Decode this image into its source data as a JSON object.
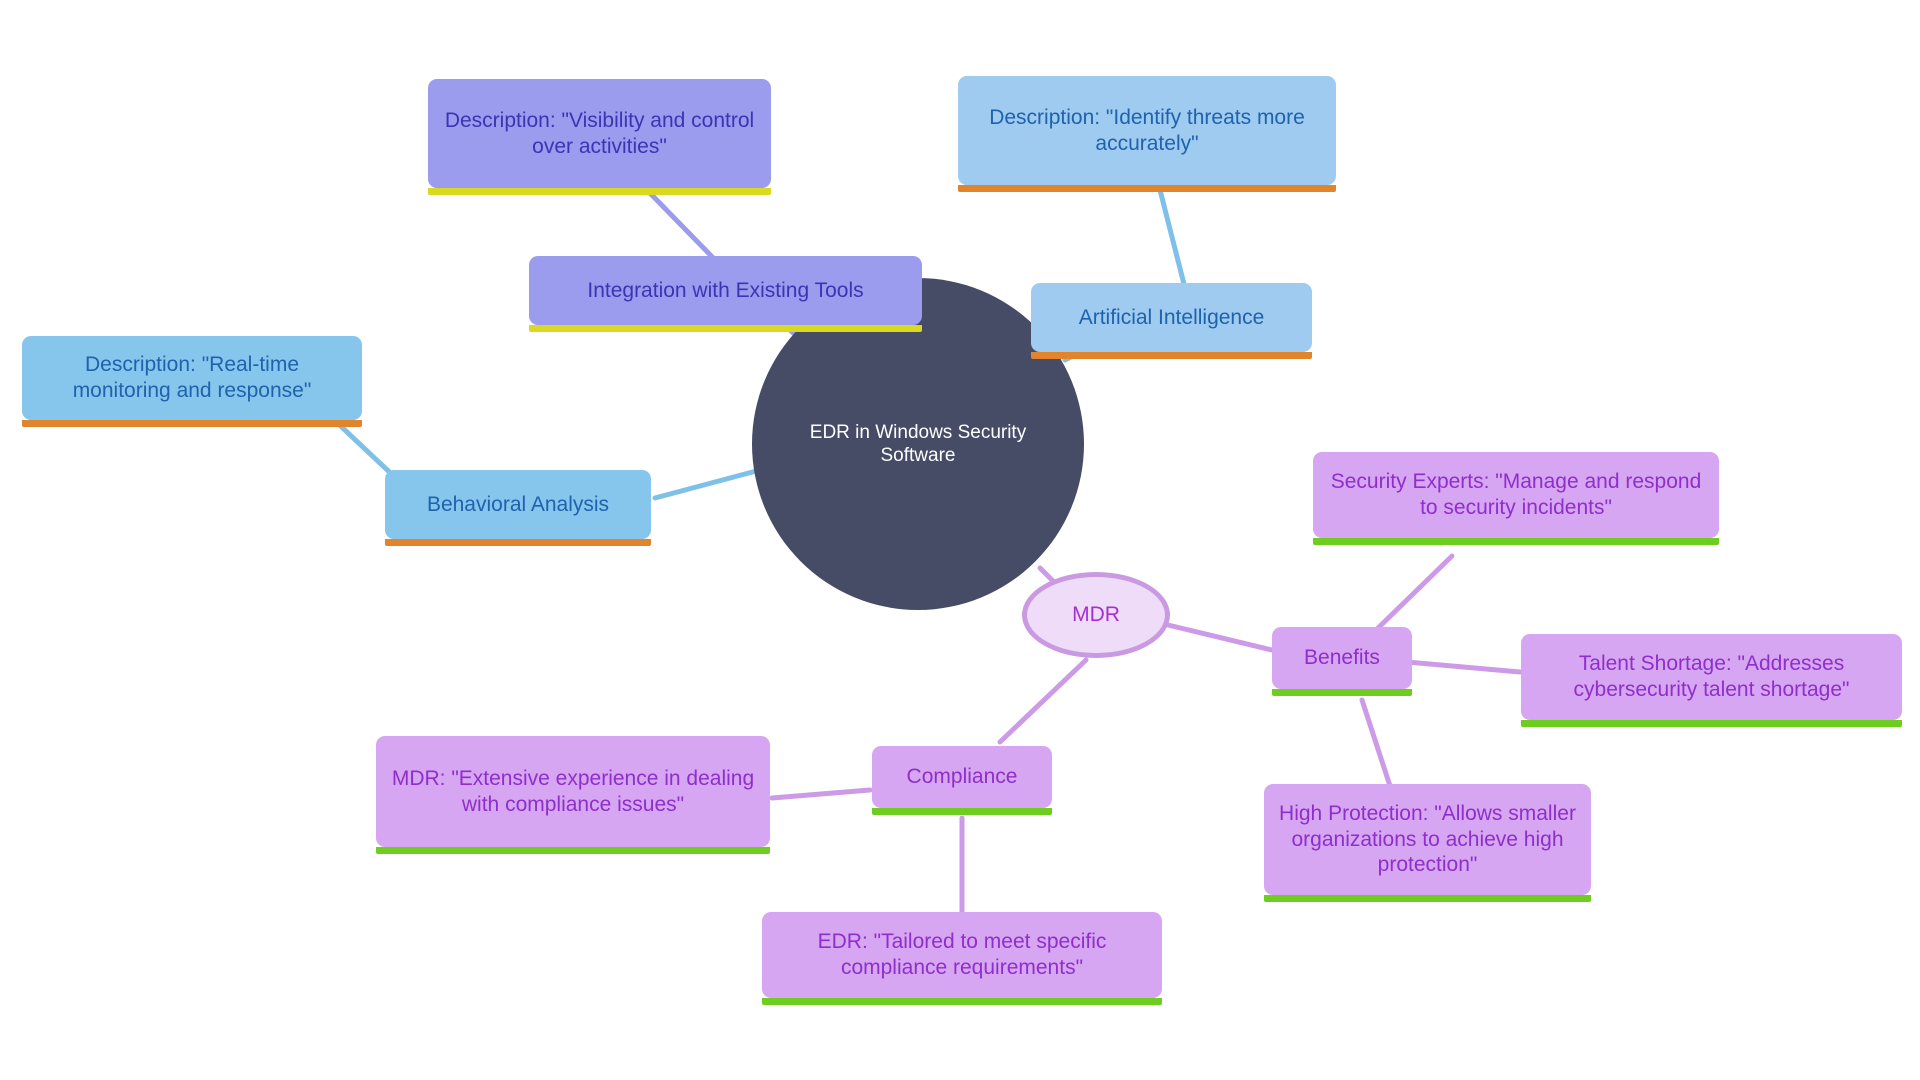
{
  "diagram": {
    "type": "mindmap",
    "title": "EDR in Windows Security Software",
    "background": "#ffffff",
    "palette": {
      "center_fill": "#464b66",
      "center_text": "#ffffff",
      "periwinkle_fill": "#9b9cee",
      "periwinkle_text": "#3a35b5",
      "lightblue_fill": "#9ecbef",
      "skyblue_fill": "#86c5ec",
      "blue_text": "#1f62ad",
      "violet_fill": "#d7a6f2",
      "violet_text": "#8e2ecb",
      "lavender_fill": "#efdcf8",
      "lavender_border": "#c99ae2",
      "lavender_text": "#a72ed6",
      "accent_yellow": "#d9d920",
      "accent_orange": "#e2842c",
      "accent_green": "#6ece20",
      "edge_blue": "#7fc0e8",
      "edge_periwinkle": "#9b9cee",
      "edge_violet": "#cc9ae6"
    }
  },
  "nodes": {
    "center": {
      "id": "center",
      "label": "EDR in Windows Security Software",
      "shape": "circle"
    },
    "integration": {
      "id": "integration",
      "label": "Integration with Existing Tools",
      "shape": "rect",
      "accent": "yellow"
    },
    "integration_desc": {
      "id": "integration-description",
      "label": "Description: \"Visibility and control over activities\"",
      "shape": "rect",
      "accent": "yellow"
    },
    "ai": {
      "id": "artificial-intelligence",
      "label": "Artificial Intelligence",
      "shape": "rect",
      "accent": "orange"
    },
    "ai_desc": {
      "id": "artificial-intelligence-description",
      "label": "Description: \"Identify threats more accurately\"",
      "shape": "rect",
      "accent": "orange"
    },
    "behavioral": {
      "id": "behavioral-analysis",
      "label": "Behavioral Analysis",
      "shape": "rect",
      "accent": "orange"
    },
    "behavioral_desc": {
      "id": "behavioral-analysis-description",
      "label": "Description: \"Real-time monitoring and response\"",
      "shape": "rect",
      "accent": "orange"
    },
    "mdr": {
      "id": "mdr",
      "label": "MDR",
      "shape": "ellipse"
    },
    "benefits": {
      "id": "benefits",
      "label": "Benefits",
      "shape": "rect",
      "accent": "green"
    },
    "security_experts": {
      "id": "security-experts",
      "label": "Security Experts: \"Manage and respond to security incidents\"",
      "shape": "rect",
      "accent": "green"
    },
    "talent_shortage": {
      "id": "talent-shortage",
      "label": "Talent Shortage: \"Addresses cybersecurity talent shortage\"",
      "shape": "rect",
      "accent": "green"
    },
    "high_protection": {
      "id": "high-protection",
      "label": "High Protection: \"Allows smaller organizations to achieve high protection\"",
      "shape": "rect",
      "accent": "green"
    },
    "compliance": {
      "id": "compliance",
      "label": "Compliance",
      "shape": "rect",
      "accent": "green"
    },
    "compliance_mdr": {
      "id": "compliance-mdr",
      "label": "MDR: \"Extensive experience in dealing with compliance issues\"",
      "shape": "rect",
      "accent": "green"
    },
    "compliance_edr": {
      "id": "compliance-edr",
      "label": "EDR: \"Tailored to meet specific compliance requirements\"",
      "shape": "rect",
      "accent": "green"
    }
  },
  "edges": [
    {
      "from": "integration_desc",
      "to": "integration",
      "color": "#9b9cee"
    },
    {
      "from": "integration",
      "to": "center",
      "color": "#9b9cee"
    },
    {
      "from": "ai_desc",
      "to": "ai",
      "color": "#7fc0e8"
    },
    {
      "from": "ai",
      "to": "center",
      "color": "#7fc0e8"
    },
    {
      "from": "behavioral_desc",
      "to": "behavioral",
      "color": "#7fc0e8"
    },
    {
      "from": "behavioral",
      "to": "center",
      "color": "#7fc0e8"
    },
    {
      "from": "center",
      "to": "mdr",
      "color": "#cc9ae6"
    },
    {
      "from": "mdr",
      "to": "benefits",
      "color": "#cc9ae6"
    },
    {
      "from": "benefits",
      "to": "security_experts",
      "color": "#cc9ae6"
    },
    {
      "from": "benefits",
      "to": "talent_shortage",
      "color": "#cc9ae6"
    },
    {
      "from": "benefits",
      "to": "high_protection",
      "color": "#cc9ae6"
    },
    {
      "from": "mdr",
      "to": "compliance",
      "color": "#cc9ae6"
    },
    {
      "from": "compliance",
      "to": "compliance_mdr",
      "color": "#cc9ae6"
    },
    {
      "from": "compliance",
      "to": "compliance_edr",
      "color": "#cc9ae6"
    }
  ]
}
